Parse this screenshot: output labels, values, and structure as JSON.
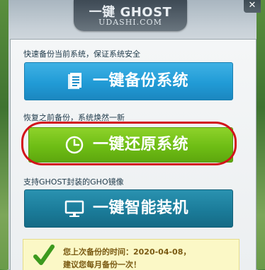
{
  "header": {
    "title": "一键 GHOST",
    "subtitle": "UDASHI.COM",
    "close_symbol": "✕"
  },
  "sections": {
    "backup": {
      "description": "快速备份当前系统，保证系统安全",
      "button_label": "一键备份系统",
      "icon": "document-icon"
    },
    "restore": {
      "description": "恢复之前备份，系统焕然一新",
      "button_label": "一键还原系统",
      "icon": "clock-icon"
    },
    "install": {
      "description": "支持GHOST封装的GHO镜像",
      "button_label": "一键智能装机",
      "icon": "monitor-icon"
    }
  },
  "notice": {
    "line1": "您上次备份的时间：2020-04-08，",
    "line2": "建议您每月备份一次！",
    "icon": "checkmark-icon"
  },
  "colors": {
    "backup_button": "#219bd6",
    "restore_button": "#6ebd15",
    "install_button": "#1b7c9a",
    "highlight_ring": "#d2131a",
    "notice_background": "#fbf8c6",
    "check_green": "#3d9a1e"
  }
}
